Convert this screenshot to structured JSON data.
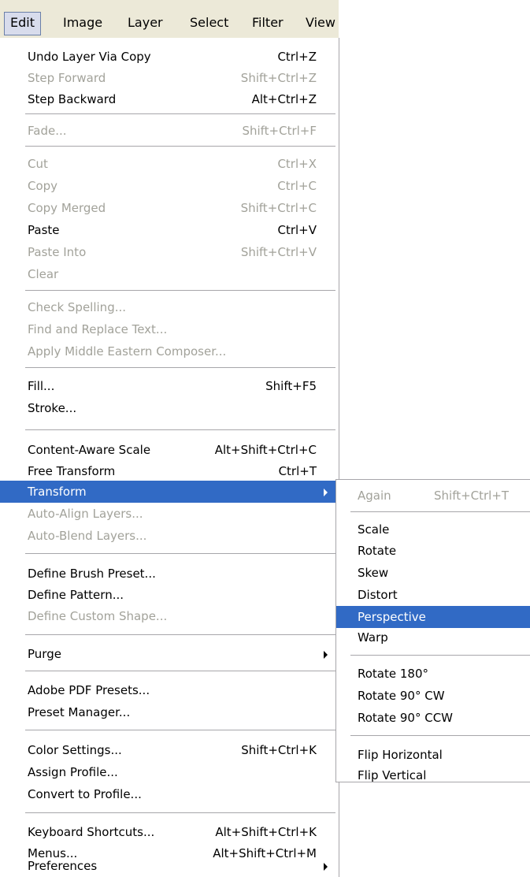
{
  "menubar": {
    "edit": "Edit",
    "image": "Image",
    "layer": "Layer",
    "select": "Select",
    "filter": "Filter",
    "view": "View"
  },
  "edit_menu": [
    {
      "label": "Undo Layer Via Copy",
      "shortcut": "Ctrl+Z"
    },
    {
      "label": "Step Forward",
      "shortcut": "Shift+Ctrl+Z"
    },
    {
      "label": "Step Backward",
      "shortcut": "Alt+Ctrl+Z"
    },
    {
      "label": "Fade...",
      "shortcut": "Shift+Ctrl+F"
    },
    {
      "label": "Cut",
      "shortcut": "Ctrl+X"
    },
    {
      "label": "Copy",
      "shortcut": "Ctrl+C"
    },
    {
      "label": "Copy Merged",
      "shortcut": "Shift+Ctrl+C"
    },
    {
      "label": "Paste",
      "shortcut": "Ctrl+V"
    },
    {
      "label": "Paste Into",
      "shortcut": "Shift+Ctrl+V"
    },
    {
      "label": "Clear",
      "shortcut": ""
    },
    {
      "label": "Check Spelling...",
      "shortcut": ""
    },
    {
      "label": "Find and Replace Text...",
      "shortcut": ""
    },
    {
      "label": "Apply Middle Eastern Composer...",
      "shortcut": ""
    },
    {
      "label": "Fill...",
      "shortcut": "Shift+F5"
    },
    {
      "label": "Stroke...",
      "shortcut": ""
    },
    {
      "label": "Content-Aware Scale",
      "shortcut": "Alt+Shift+Ctrl+C"
    },
    {
      "label": "Free Transform",
      "shortcut": "Ctrl+T"
    },
    {
      "label": "Transform",
      "shortcut": ""
    },
    {
      "label": "Auto-Align Layers...",
      "shortcut": ""
    },
    {
      "label": "Auto-Blend Layers...",
      "shortcut": ""
    },
    {
      "label": "Define Brush Preset...",
      "shortcut": ""
    },
    {
      "label": "Define Pattern...",
      "shortcut": ""
    },
    {
      "label": "Define Custom Shape...",
      "shortcut": ""
    },
    {
      "label": "Purge",
      "shortcut": ""
    },
    {
      "label": "Adobe PDF Presets...",
      "shortcut": ""
    },
    {
      "label": "Preset Manager...",
      "shortcut": ""
    },
    {
      "label": "Color Settings...",
      "shortcut": "Shift+Ctrl+K"
    },
    {
      "label": "Assign Profile...",
      "shortcut": ""
    },
    {
      "label": "Convert to Profile...",
      "shortcut": ""
    },
    {
      "label": "Keyboard Shortcuts...",
      "shortcut": "Alt+Shift+Ctrl+K"
    },
    {
      "label": "Menus...",
      "shortcut": "Alt+Shift+Ctrl+M"
    },
    {
      "label": "Preferences",
      "shortcut": ""
    }
  ],
  "transform_submenu": [
    {
      "label": "Again",
      "shortcut": "Shift+Ctrl+T"
    },
    {
      "label": "Scale",
      "shortcut": ""
    },
    {
      "label": "Rotate",
      "shortcut": ""
    },
    {
      "label": "Skew",
      "shortcut": ""
    },
    {
      "label": "Distort",
      "shortcut": ""
    },
    {
      "label": "Perspective",
      "shortcut": ""
    },
    {
      "label": "Warp",
      "shortcut": ""
    },
    {
      "label": "Rotate 180°",
      "shortcut": ""
    },
    {
      "label": "Rotate 90° CW",
      "shortcut": ""
    },
    {
      "label": "Rotate 90° CCW",
      "shortcut": ""
    },
    {
      "label": "Flip Horizontal",
      "shortcut": ""
    },
    {
      "label": "Flip Vertical",
      "shortcut": ""
    }
  ],
  "colors": {
    "highlight": "#316ac5",
    "disabled_text": "#a2a29a",
    "menubar_bg": "#ece9d8"
  },
  "icons": {
    "submenu_arrow": "triangle-right-icon"
  }
}
